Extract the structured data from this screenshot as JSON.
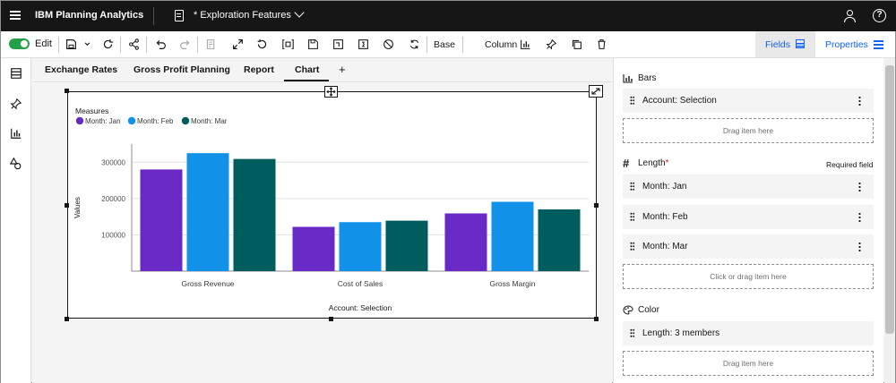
{
  "header": {
    "brand": "IBM Planning Analytics",
    "workbook_title": "* Exploration Features"
  },
  "toolbar": {
    "edit_label": "Edit",
    "base_label": "Base",
    "column_label": "Column",
    "fields_label": "Fields",
    "properties_label": "Properties"
  },
  "tabs": [
    {
      "label": "Exchange Rates"
    },
    {
      "label": "Gross Profit Planning"
    },
    {
      "label": "Report"
    },
    {
      "label": "Chart"
    }
  ],
  "tab_add": "+",
  "chart_data": {
    "type": "bar",
    "legend_title": "Measures",
    "legend_position": "top-left",
    "categories": [
      "Gross Revenue",
      "Cost of Sales",
      "Gross Margin"
    ],
    "series": [
      {
        "name": "Month: Jan",
        "color": "#6929c4",
        "values": [
          280000,
          122000,
          159000
        ]
      },
      {
        "name": "Month: Feb",
        "color": "#1192e8",
        "values": [
          325000,
          135000,
          191000
        ]
      },
      {
        "name": "Month: Mar",
        "color": "#005d5d",
        "values": [
          309000,
          139000,
          170000
        ]
      }
    ],
    "ylabel": "Values",
    "xlabel": "Account: Selection",
    "yticks": [
      "300000",
      "200000",
      "100000"
    ],
    "ylim": [
      0,
      350000
    ],
    "grid": true
  },
  "panel": {
    "bars": {
      "title": "Bars",
      "items": [
        {
          "label": "Account: Selection"
        }
      ],
      "dropzone": "Drag item here"
    },
    "length": {
      "title": "Length",
      "required_marker": "*",
      "required_text": "Required field",
      "items": [
        {
          "label": "Month: Jan"
        },
        {
          "label": "Month: Feb"
        },
        {
          "label": "Month: Mar"
        }
      ],
      "dropzone": "Click or drag item here"
    },
    "color": {
      "title": "Color",
      "items": [
        {
          "label": "Length: 3 members"
        }
      ],
      "dropzone": "Drag item here"
    }
  }
}
